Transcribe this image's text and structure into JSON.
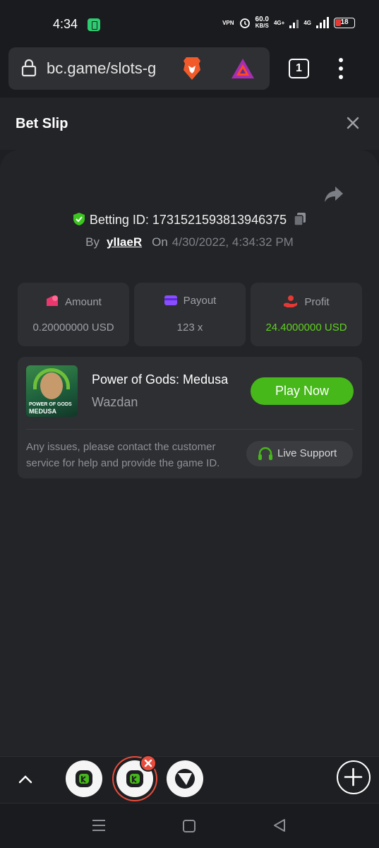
{
  "status_bar": {
    "time": "4:34",
    "net_speed_value": "60.0",
    "net_speed_unit": "KB/S",
    "vpn": "VPN",
    "network_a": "4G+",
    "network_b": "4G",
    "battery_level": "18"
  },
  "browser": {
    "url": "bc.game/slots-g",
    "tab_count": "1"
  },
  "header": {
    "title": "Bet Slip"
  },
  "bet": {
    "betting_id_label": "Betting ID:",
    "betting_id": "1731521593813946375",
    "by_label": "By",
    "username": "ylIaeR",
    "on_label": "On",
    "date": "4/30/2022, 4:34:32 PM"
  },
  "stats": {
    "amount_label": "Amount",
    "amount_value": "0.20000000 USD",
    "payout_label": "Payout",
    "payout_value": "123 x",
    "profit_label": "Profit",
    "profit_value": "24.4000000 USD"
  },
  "game": {
    "thumb_line1": "POWER OF GODS",
    "thumb_line2": "MEDUSA",
    "name": "Power of Gods: Medusa",
    "provider": "Wazdan",
    "play_label": "Play Now",
    "help_text": "Any issues, please contact the customer service for help and provide the game ID.",
    "support_label": "Live Support"
  },
  "colors": {
    "accent_green": "#46b81a",
    "profit_green": "#5fd11e",
    "close_red": "#e74c3c"
  }
}
